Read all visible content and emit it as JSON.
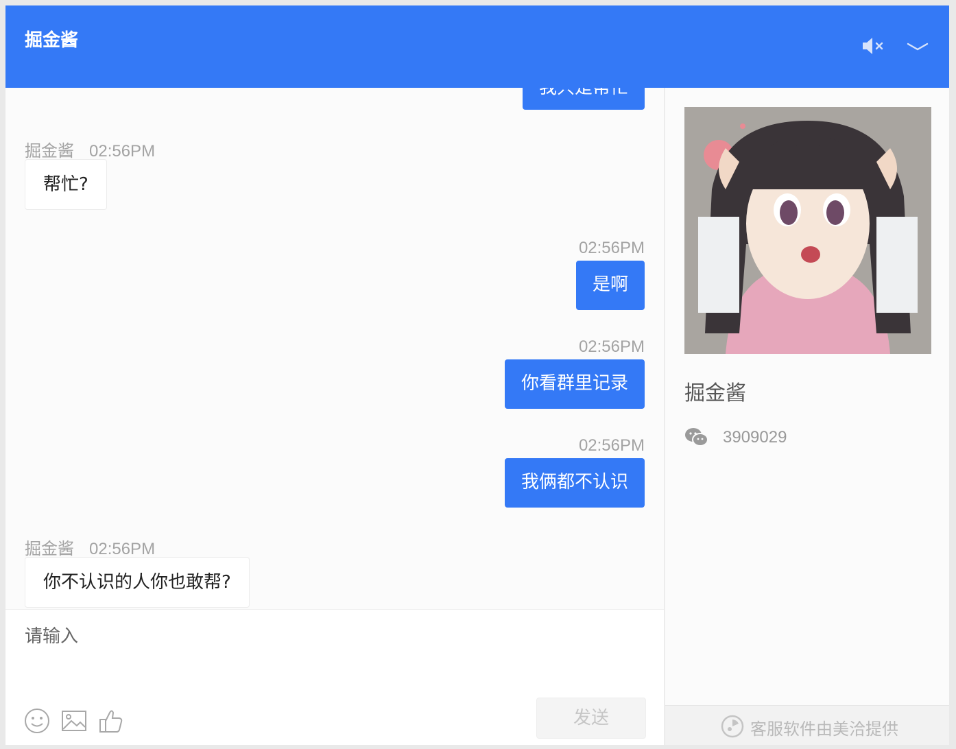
{
  "header": {
    "title": "掘金酱",
    "accent_color": "#3479f6",
    "mute_icon": "speaker-muted-icon",
    "collapse_icon": "chevron-down-icon"
  },
  "messages": [
    {
      "direction": "out",
      "text": "我只是帮忙"
    },
    {
      "direction": "in",
      "sender": "掘金酱",
      "time": "02:56PM",
      "text": "帮忙?"
    },
    {
      "direction": "out",
      "time": "02:56PM",
      "text": "是啊"
    },
    {
      "direction": "out",
      "time": "02:56PM",
      "text": "你看群里记录"
    },
    {
      "direction": "out",
      "time": "02:56PM",
      "text": "我俩都不认识"
    },
    {
      "direction": "in",
      "sender": "掘金酱",
      "time": "02:56PM",
      "text": "你不认识的人你也敢帮?"
    }
  ],
  "composer": {
    "placeholder": "请输入",
    "send_label": "发送",
    "tools": [
      "emoji-icon",
      "image-icon",
      "thumbs-up-icon"
    ]
  },
  "profile": {
    "name": "掘金酱",
    "wechat_icon": "wechat-icon",
    "wechat_id": "3909029"
  },
  "footer": {
    "icon": "meiqia-logo-icon",
    "text": "客服软件由美洽提供"
  }
}
